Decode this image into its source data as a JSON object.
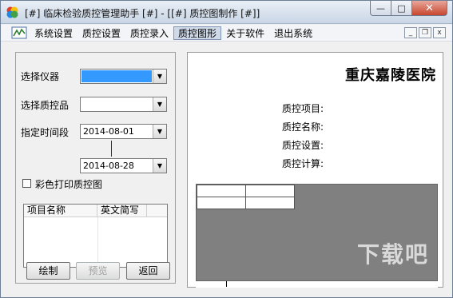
{
  "window": {
    "title": "[#] 临床检验质控管理助手 [#] - [[#] 质控图制作 [#]]",
    "caption": {
      "minimize": "—",
      "maximize": "□",
      "close": "✕"
    }
  },
  "menu": {
    "items": [
      {
        "label": "系统设置"
      },
      {
        "label": "质控设置"
      },
      {
        "label": "质控录入"
      },
      {
        "label": "质控图形"
      },
      {
        "label": "关于软件"
      },
      {
        "label": "退出系统"
      }
    ],
    "active_index": 3,
    "mdi": {
      "minimize": "_",
      "restore": "❐",
      "close": "x"
    }
  },
  "form": {
    "instrument_label": "选择仪器",
    "instrument_value": "",
    "qc_label": "选择质控品",
    "qc_value": "",
    "period_label": "指定时间段",
    "date_from": "2014-08-01",
    "date_to": "2014-08-28",
    "color_print_label": "彩色打印质控图",
    "color_print_checked": false
  },
  "list": {
    "headers": [
      "项目名称",
      "英文简写",
      ""
    ]
  },
  "buttons": {
    "draw": "绘制",
    "preview": "预览",
    "back": "返回"
  },
  "report": {
    "hospital": "重庆嘉陵医院",
    "fields": [
      "质控项目:",
      "质控名称:",
      "质控设置:",
      "质控计算:"
    ]
  },
  "watermark": "下载吧"
}
